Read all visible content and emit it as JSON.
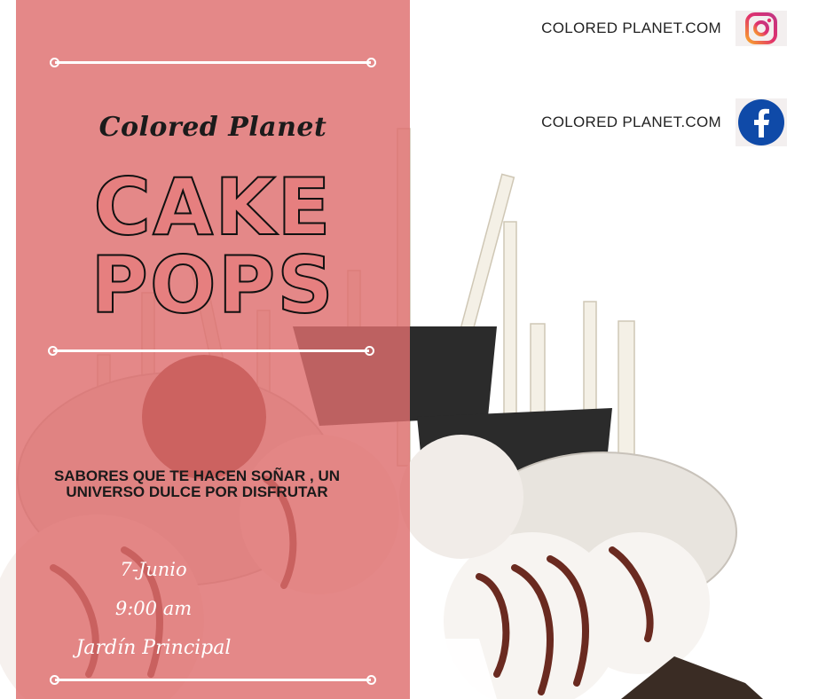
{
  "brand": "Colored Planet",
  "title_line1": "CAKE",
  "title_line2": "POPS",
  "tagline": "SABORES QUE TE HACEN SOÑAR , UN UNIVERSO DULCE POR DISFRUTAR",
  "event": {
    "date": "7-Junio",
    "time": "9:00 am",
    "place": "Jardín Principal"
  },
  "social": [
    {
      "label": "COLORED PLANET.COM",
      "icon": "instagram-icon"
    },
    {
      "label": "COLORED PLANET.COM",
      "icon": "facebook-icon"
    }
  ],
  "colors": {
    "panel": "#de6e6e",
    "title_fill": "#e67f7f",
    "instagram": "#e1306c",
    "facebook": "#1877f2"
  }
}
